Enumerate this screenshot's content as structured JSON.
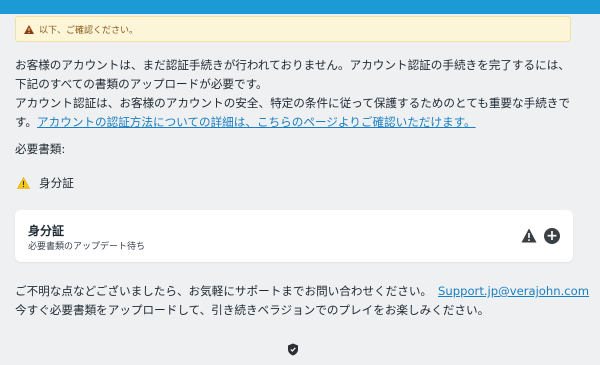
{
  "notice": {
    "text": "以下、ご確認ください。"
  },
  "intro": {
    "line1": "お客様のアカウントは、まだ認証手続きが行われておりません。アカウント認証の手続きを完了するには、",
    "line2": "下記のすべての書類のアップロードが必要です。",
    "line3": "アカウント認証は、お客様のアカウントの安全、特定の条件に従って保護するためのとても重要な手続きで",
    "line4_prefix": "す。",
    "link": "アカウントの認証方法についての詳細は、こちらのページよりご確認いただけます。"
  },
  "required": {
    "label": "必要書類:"
  },
  "documents": [
    {
      "name": "身分証",
      "status": "必要書類のアップデート待ち"
    }
  ],
  "contact": {
    "line1": "ご不明な点などございましたら、お気軽にサポートまでお問い合わせください。",
    "email": "Support.jp@verajohn.com",
    "line2": "今すぐ必要書類をアップロードして、引き続きベラジョンでのプレイをお楽しみください。"
  },
  "colors": {
    "topbar": "#1c9ad6",
    "link": "#1a7fc0",
    "warning_yellow": "#f5c518",
    "notice_bg": "#fcf5d7"
  },
  "icons": {
    "notice": "warning-triangle-icon",
    "doc_status": "warning-triangle-icon",
    "card_warn": "warning-triangle-icon",
    "card_add": "plus-circle-icon",
    "footer": "shield-icon"
  }
}
